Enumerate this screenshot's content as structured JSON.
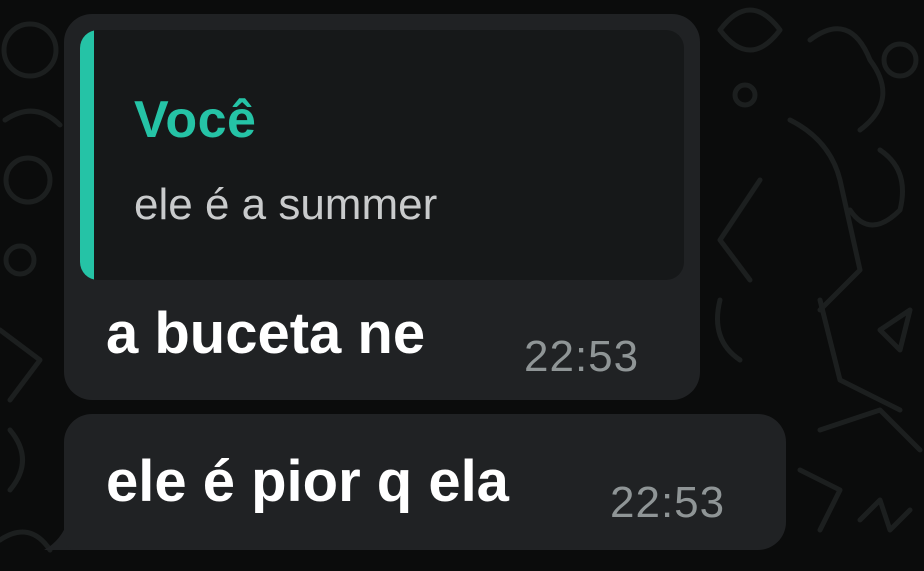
{
  "colors": {
    "background": "#0b0c0c",
    "bubble": "#202224",
    "quote_background": "#161819",
    "accent": "#25c3a6",
    "message_text": "#ffffff",
    "quote_text": "#c9cbcc",
    "timestamp": "#8f9596"
  },
  "messages": [
    {
      "reply_to": {
        "author": "Você",
        "text": "ele é a summer"
      },
      "text": "a buceta ne",
      "time": "22:53"
    },
    {
      "text": "ele é pior q ela",
      "time": "22:53"
    }
  ],
  "wallpaper": {
    "icon": "doodle-pattern-icon"
  }
}
